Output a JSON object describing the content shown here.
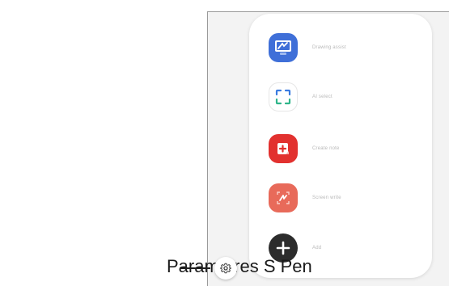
{
  "callout": {
    "settings_label": "Paramètres S Pen"
  },
  "menu": {
    "items": [
      {
        "label": "Drawing assist",
        "icon": "drawing-assist-icon",
        "color": "#3f6fd8"
      },
      {
        "label": "AI select",
        "icon": "ai-select-icon",
        "color": "#ffffff"
      },
      {
        "label": "Create note",
        "icon": "create-note-icon",
        "color": "#e2312f"
      },
      {
        "label": "Screen write",
        "icon": "screen-write-icon",
        "color": "#e86a5a"
      },
      {
        "label": "Add",
        "icon": "add-icon",
        "color": "#2c2c2c"
      }
    ]
  },
  "colors": {
    "frame_background": "#f3f3f3",
    "panel_background": "#ffffff"
  }
}
